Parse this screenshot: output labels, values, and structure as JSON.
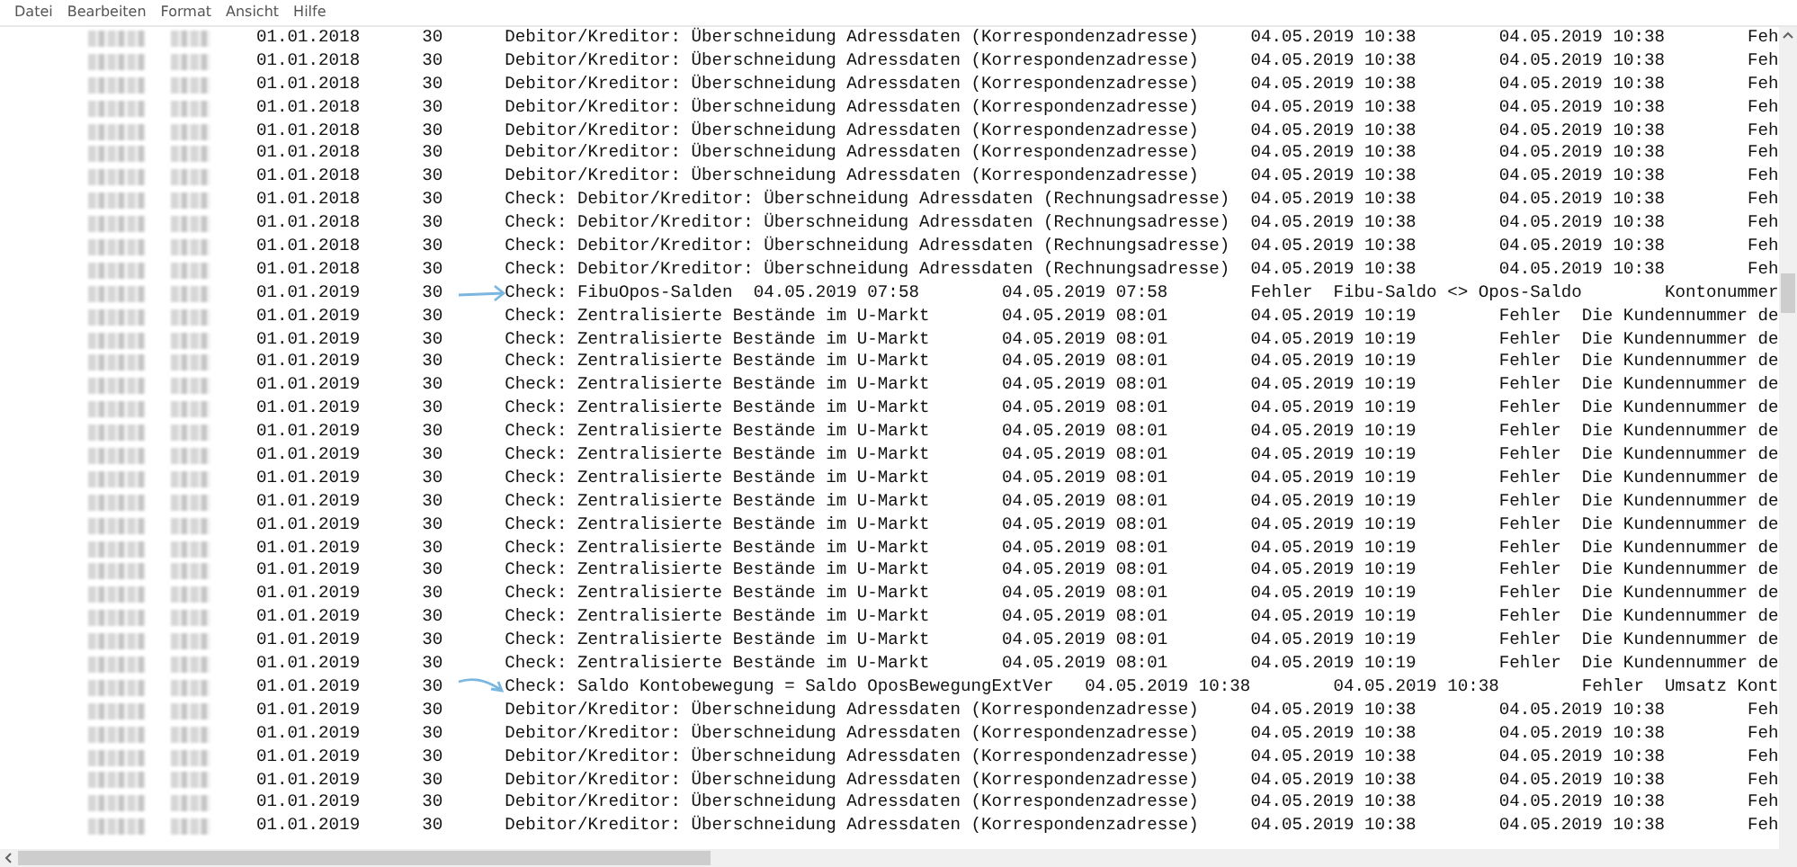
{
  "menu": [
    "Datei",
    "Bearbeiten",
    "Format",
    "Ansicht",
    "Hilfe"
  ],
  "lines": [
    {
      "kind": "plain",
      "date": "01.01.2018",
      "count": "30",
      "text": "Debitor/Kreditor: Überschneidung Adressdaten (Korrespondenzadresse)\t04.05.2019 10:38\t04.05.2019 10:38\tFeh"
    },
    {
      "kind": "plain",
      "date": "01.01.2018",
      "count": "30",
      "text": "Debitor/Kreditor: Überschneidung Adressdaten (Korrespondenzadresse)\t04.05.2019 10:38\t04.05.2019 10:38\tFeh"
    },
    {
      "kind": "plain",
      "date": "01.01.2018",
      "count": "30",
      "text": "Debitor/Kreditor: Überschneidung Adressdaten (Korrespondenzadresse)\t04.05.2019 10:38\t04.05.2019 10:38\tFeh"
    },
    {
      "kind": "plain",
      "date": "01.01.2018",
      "count": "30",
      "text": "Debitor/Kreditor: Überschneidung Adressdaten (Korrespondenzadresse)\t04.05.2019 10:38\t04.05.2019 10:38\tFeh"
    },
    {
      "kind": "plain",
      "date": "01.01.2018",
      "count": "30",
      "text": "Debitor/Kreditor: Überschneidung Adressdaten (Korrespondenzadresse)\t04.05.2019 10:38\t04.05.2019 10:38\tFeh"
    },
    {
      "kind": "plain",
      "date": "01.01.2018",
      "count": "30",
      "text": "Debitor/Kreditor: Überschneidung Adressdaten (Korrespondenzadresse)\t04.05.2019 10:38\t04.05.2019 10:38\tFeh"
    },
    {
      "kind": "plain",
      "date": "01.01.2018",
      "count": "30",
      "text": "Debitor/Kreditor: Überschneidung Adressdaten (Korrespondenzadresse)\t04.05.2019 10:38\t04.05.2019 10:38\tFeh"
    },
    {
      "kind": "plain",
      "date": "01.01.2018",
      "count": "30",
      "text": "Check: Debitor/Kreditor: Überschneidung Adressdaten (Rechnungsadresse)\t04.05.2019 10:38\t04.05.2019 10:38\tFeh"
    },
    {
      "kind": "plain",
      "date": "01.01.2018",
      "count": "30",
      "text": "Check: Debitor/Kreditor: Überschneidung Adressdaten (Rechnungsadresse)\t04.05.2019 10:38\t04.05.2019 10:38\tFeh"
    },
    {
      "kind": "plain",
      "date": "01.01.2018",
      "count": "30",
      "text": "Check: Debitor/Kreditor: Überschneidung Adressdaten (Rechnungsadresse)\t04.05.2019 10:38\t04.05.2019 10:38\tFeh"
    },
    {
      "kind": "plain",
      "date": "01.01.2018",
      "count": "30",
      "text": "Check: Debitor/Kreditor: Überschneidung Adressdaten (Rechnungsadresse)\t04.05.2019 10:38\t04.05.2019 10:38\tFeh"
    },
    {
      "kind": "arrow",
      "date": "01.01.2019",
      "count": "30",
      "text": "Check: FibuOpos-Salden\t04.05.2019 07:58\t04.05.2019 07:58\tFehler\tFibu-Saldo <> Opos-Saldo\tKontonummer"
    },
    {
      "kind": "plain",
      "date": "01.01.2019",
      "count": "30",
      "text": "Check: Zentralisierte Bestände im U-Markt\t04.05.2019 08:01\t04.05.2019 10:19\tFehler\tDie Kundennummer de"
    },
    {
      "kind": "plain",
      "date": "01.01.2019",
      "count": "30",
      "text": "Check: Zentralisierte Bestände im U-Markt\t04.05.2019 08:01\t04.05.2019 10:19\tFehler\tDie Kundennummer de"
    },
    {
      "kind": "plain",
      "date": "01.01.2019",
      "count": "30",
      "text": "Check: Zentralisierte Bestände im U-Markt\t04.05.2019 08:01\t04.05.2019 10:19\tFehler\tDie Kundennummer de"
    },
    {
      "kind": "plain",
      "date": "01.01.2019",
      "count": "30",
      "text": "Check: Zentralisierte Bestände im U-Markt\t04.05.2019 08:01\t04.05.2019 10:19\tFehler\tDie Kundennummer de"
    },
    {
      "kind": "plain",
      "date": "01.01.2019",
      "count": "30",
      "text": "Check: Zentralisierte Bestände im U-Markt\t04.05.2019 08:01\t04.05.2019 10:19\tFehler\tDie Kundennummer de"
    },
    {
      "kind": "plain",
      "date": "01.01.2019",
      "count": "30",
      "text": "Check: Zentralisierte Bestände im U-Markt\t04.05.2019 08:01\t04.05.2019 10:19\tFehler\tDie Kundennummer de"
    },
    {
      "kind": "plain",
      "date": "01.01.2019",
      "count": "30",
      "text": "Check: Zentralisierte Bestände im U-Markt\t04.05.2019 08:01\t04.05.2019 10:19\tFehler\tDie Kundennummer de"
    },
    {
      "kind": "plain",
      "date": "01.01.2019",
      "count": "30",
      "text": "Check: Zentralisierte Bestände im U-Markt\t04.05.2019 08:01\t04.05.2019 10:19\tFehler\tDie Kundennummer de"
    },
    {
      "kind": "plain",
      "date": "01.01.2019",
      "count": "30",
      "text": "Check: Zentralisierte Bestände im U-Markt\t04.05.2019 08:01\t04.05.2019 10:19\tFehler\tDie Kundennummer de"
    },
    {
      "kind": "plain",
      "date": "01.01.2019",
      "count": "30",
      "text": "Check: Zentralisierte Bestände im U-Markt\t04.05.2019 08:01\t04.05.2019 10:19\tFehler\tDie Kundennummer de"
    },
    {
      "kind": "plain",
      "date": "01.01.2019",
      "count": "30",
      "text": "Check: Zentralisierte Bestände im U-Markt\t04.05.2019 08:01\t04.05.2019 10:19\tFehler\tDie Kundennummer de"
    },
    {
      "kind": "plain",
      "date": "01.01.2019",
      "count": "30",
      "text": "Check: Zentralisierte Bestände im U-Markt\t04.05.2019 08:01\t04.05.2019 10:19\tFehler\tDie Kundennummer de"
    },
    {
      "kind": "plain",
      "date": "01.01.2019",
      "count": "30",
      "text": "Check: Zentralisierte Bestände im U-Markt\t04.05.2019 08:01\t04.05.2019 10:19\tFehler\tDie Kundennummer de"
    },
    {
      "kind": "plain",
      "date": "01.01.2019",
      "count": "30",
      "text": "Check: Zentralisierte Bestände im U-Markt\t04.05.2019 08:01\t04.05.2019 10:19\tFehler\tDie Kundennummer de"
    },
    {
      "kind": "plain",
      "date": "01.01.2019",
      "count": "30",
      "text": "Check: Zentralisierte Bestände im U-Markt\t04.05.2019 08:01\t04.05.2019 10:19\tFehler\tDie Kundennummer de"
    },
    {
      "kind": "plain",
      "date": "01.01.2019",
      "count": "30",
      "text": "Check: Zentralisierte Bestände im U-Markt\t04.05.2019 08:01\t04.05.2019 10:19\tFehler\tDie Kundennummer de"
    },
    {
      "kind": "hook",
      "date": "01.01.2019",
      "count": "30",
      "text": "Check: Saldo Kontobewegung = Saldo OposBewegungExtVer\t04.05.2019 10:38\t04.05.2019 10:38\tFehler\tUmsatz Kont"
    },
    {
      "kind": "plain",
      "date": "01.01.2019",
      "count": "30",
      "text": "Debitor/Kreditor: Überschneidung Adressdaten (Korrespondenzadresse)\t04.05.2019 10:38\t04.05.2019 10:38\tFeh"
    },
    {
      "kind": "plain",
      "date": "01.01.2019",
      "count": "30",
      "text": "Debitor/Kreditor: Überschneidung Adressdaten (Korrespondenzadresse)\t04.05.2019 10:38\t04.05.2019 10:38\tFeh"
    },
    {
      "kind": "plain",
      "date": "01.01.2019",
      "count": "30",
      "text": "Debitor/Kreditor: Überschneidung Adressdaten (Korrespondenzadresse)\t04.05.2019 10:38\t04.05.2019 10:38\tFeh"
    },
    {
      "kind": "plain",
      "date": "01.01.2019",
      "count": "30",
      "text": "Debitor/Kreditor: Überschneidung Adressdaten (Korrespondenzadresse)\t04.05.2019 10:38\t04.05.2019 10:38\tFeh"
    },
    {
      "kind": "plain",
      "date": "01.01.2019",
      "count": "30",
      "text": "Debitor/Kreditor: Überschneidung Adressdaten (Korrespondenzadresse)\t04.05.2019 10:38\t04.05.2019 10:38\tFeh"
    },
    {
      "kind": "plain",
      "date": "01.01.2019",
      "count": "30",
      "text": "Debitor/Kreditor: Überschneidung Adressdaten (Korrespondenzadresse)\t04.05.2019 10:38\t04.05.2019 10:38\tFeh"
    }
  ]
}
